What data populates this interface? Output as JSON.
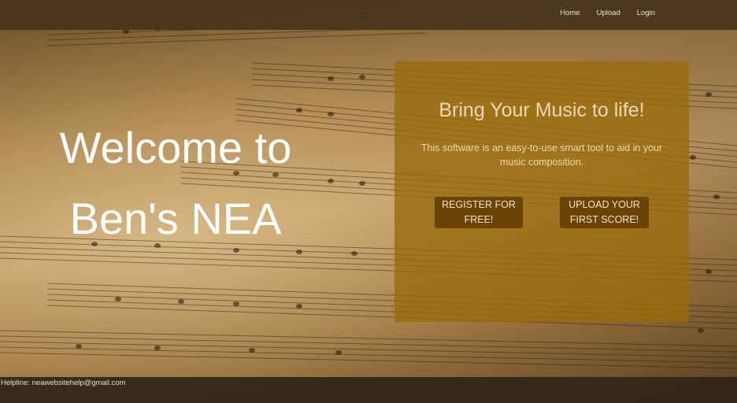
{
  "nav": {
    "home": "Home",
    "upload": "Upload",
    "login": "Login"
  },
  "hero": {
    "title_line1": "Welcome to",
    "title_line2": "Ben's NEA"
  },
  "panel": {
    "heading": "Bring Your Music to life!",
    "description": "This software is an easy-to-use smart tool to aid in your music composition.",
    "register_button_line1": "REGISTER FOR",
    "register_button_line2": "FREE!",
    "upload_button_line1": "UPLOAD YOUR",
    "upload_button_line2": "FIRST SCORE!"
  },
  "footer": {
    "helpline": "Helpline: neawebsitehelp@gmail.com"
  },
  "colors": {
    "navbar": "#46341c",
    "panel": "#996c0c",
    "button": "#6b4307",
    "footer": "#322616"
  }
}
